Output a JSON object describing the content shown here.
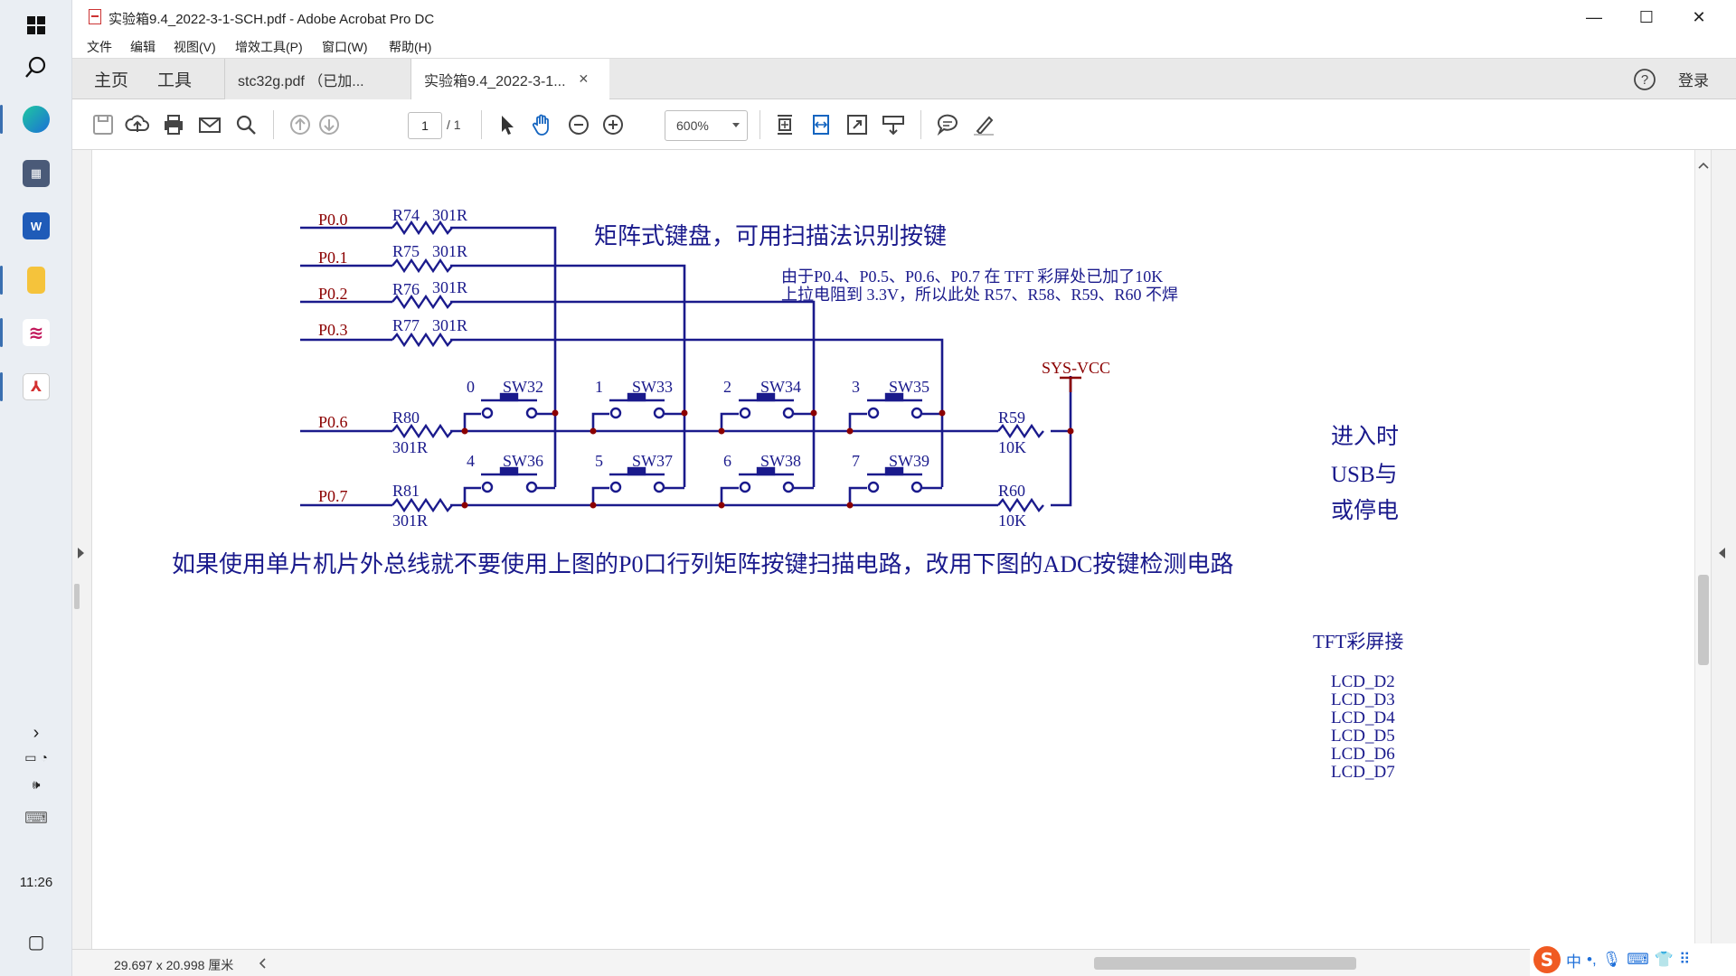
{
  "taskbar": {
    "time": "11:26"
  },
  "window": {
    "title": "实验箱9.4_2022-3-1-SCH.pdf - Adobe Acrobat Pro DC",
    "controls": {
      "minimize": "—",
      "maximize": "☐",
      "close": "✕"
    }
  },
  "menu": [
    "文件",
    "编辑",
    "视图(V)",
    "增效工具(P)",
    "窗口(W)",
    "帮助(H)"
  ],
  "tabs": {
    "home": "主页",
    "tools": "工具",
    "doc1": "stc32g.pdf （已加...",
    "doc2": "实验箱9.4_2022-3-1...",
    "doc2_close": "✕",
    "signin": "登录"
  },
  "toolbar": {
    "page_current": "1",
    "page_total": "/ 1",
    "zoom": "600%"
  },
  "status": {
    "page_size": "29.697 x 20.998 厘米"
  },
  "schematic": {
    "title": "矩阵式键盘，可用扫描法识别按键",
    "note_line1": "由于P0.4、P0.5、P0.6、P0.7 在 TFT 彩屏处已加了10K",
    "note_line2": "上拉电阻到 3.3V，所以此处 R57、R58、R59、R60 不焊",
    "rows": [
      {
        "port": "P0.0",
        "res": "R74",
        "val": "301R"
      },
      {
        "port": "P0.1",
        "res": "R75",
        "val": "301R"
      },
      {
        "port": "P0.2",
        "res": "R76",
        "val": "301R"
      },
      {
        "port": "P0.3",
        "res": "R77",
        "val": "301R"
      }
    ],
    "col_rows": [
      {
        "port": "P0.6",
        "res": "R80",
        "val": "301R",
        "pullup": "R59",
        "pullup_val": "10K"
      },
      {
        "port": "P0.7",
        "res": "R81",
        "val": "301R",
        "pullup": "R60",
        "pullup_val": "10K"
      }
    ],
    "switches_top": [
      {
        "num": "0",
        "name": "SW32"
      },
      {
        "num": "1",
        "name": "SW33"
      },
      {
        "num": "2",
        "name": "SW34"
      },
      {
        "num": "3",
        "name": "SW35"
      }
    ],
    "switches_bottom": [
      {
        "num": "4",
        "name": "SW36"
      },
      {
        "num": "5",
        "name": "SW37"
      },
      {
        "num": "6",
        "name": "SW38"
      },
      {
        "num": "7",
        "name": "SW39"
      }
    ],
    "vcc": "SYS-VCC",
    "bottom_note": "如果使用单片机片外总线就不要使用上图的P0口行列矩阵按键扫描电路，改用下图的ADC按键检测电路",
    "right_text1": "进入时",
    "right_text2": "USB与",
    "right_text3": "或停电",
    "tft_label": "TFT彩屏接",
    "lcd_lines": [
      "LCD_D2",
      "LCD_D3",
      "LCD_D4",
      "LCD_D5",
      "LCD_D6",
      "LCD_D7"
    ]
  },
  "ime": {
    "lang": "中"
  },
  "colors": {
    "wire": "#1a1a8c",
    "label": "#8b0000",
    "note": "#1a1a8c",
    "junction": "#8b0000"
  }
}
